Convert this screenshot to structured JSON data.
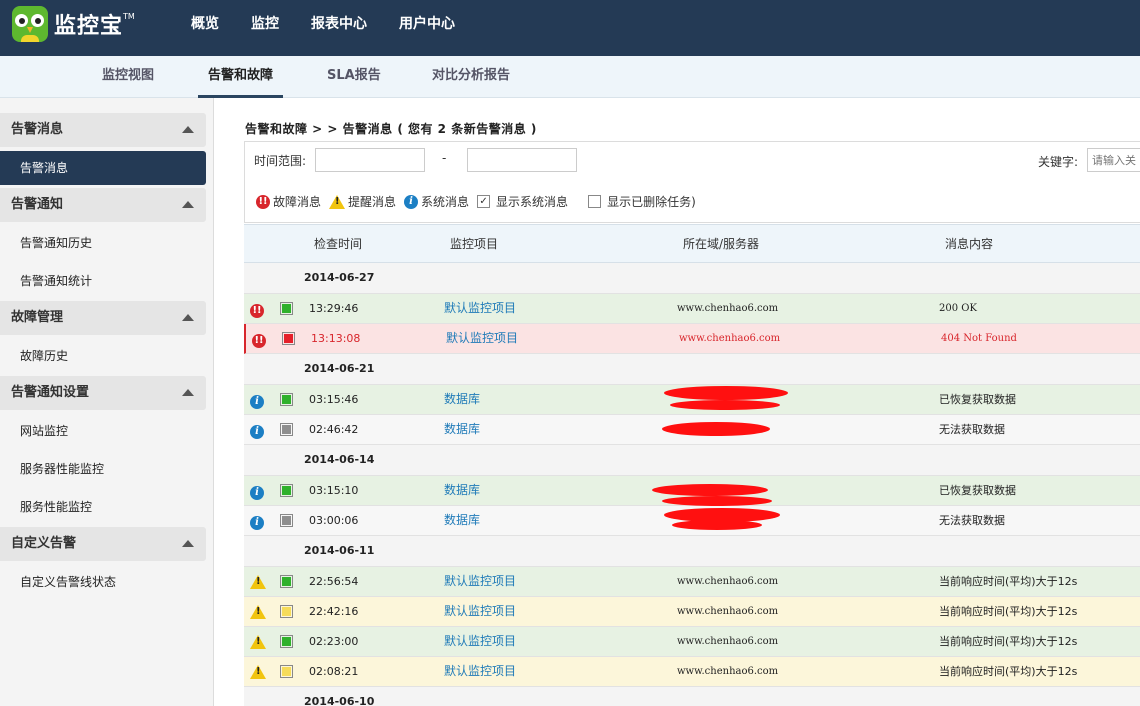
{
  "brand": {
    "name": "监控宝",
    "tm": "TM"
  },
  "topnav": [
    "概览",
    "监控",
    "报表中心",
    "用户中心"
  ],
  "subnav": [
    "监控视图",
    "告警和故障",
    "SLA报告",
    "对比分析报告"
  ],
  "sidebar": {
    "groups": [
      {
        "title": "告警消息",
        "items": [
          "告警消息"
        ]
      },
      {
        "title": "告警通知",
        "items": [
          "告警通知历史",
          "告警通知统计"
        ]
      },
      {
        "title": "故障管理",
        "items": [
          "故障历史"
        ]
      },
      {
        "title": "告警通知设置",
        "items": [
          "网站监控",
          "服务器性能监控",
          "服务性能监控"
        ]
      },
      {
        "title": "自定义告警",
        "items": [
          "自定义告警线状态"
        ]
      }
    ]
  },
  "breadcrumb": "告警和故障 > > 告警消息 ( 您有 2 条新告警消息 )",
  "filter": {
    "time_label": "时间范围:",
    "dash": "-",
    "keyword_label": "关键字:",
    "keyword_placeholder": "请输入关",
    "legend": {
      "fault": "故障消息",
      "warn": "提醒消息",
      "system": "系统消息",
      "show_system": "显示系统消息",
      "show_deleted": "显示已删除任务)"
    }
  },
  "table": {
    "headers": [
      "检查时间",
      "监控项目",
      "所在域/服务器",
      "消息内容"
    ],
    "groups": [
      {
        "date": "2014-06-27",
        "rows": [
          {
            "icon": "fault",
            "status": "green",
            "bg": "green",
            "time": "13:29:46",
            "item": "默认监控项目",
            "host": "www.chenhao6.com",
            "msg": "200 OK"
          },
          {
            "icon": "fault",
            "status": "red",
            "bg": "red",
            "time": "13:13:08",
            "item": "默认监控项目",
            "host": "www.chenhao6.com",
            "msg": "404 Not Found"
          }
        ]
      },
      {
        "date": "2014-06-21",
        "rows": [
          {
            "icon": "info",
            "status": "green",
            "bg": "green",
            "time": "03:15:46",
            "item": "数据库",
            "host": "",
            "msg": "已恢复获取数据"
          },
          {
            "icon": "info",
            "status": "gray",
            "bg": "gray",
            "time": "02:46:42",
            "item": "数据库",
            "host": "",
            "msg": "无法获取数据"
          }
        ]
      },
      {
        "date": "2014-06-14",
        "rows": [
          {
            "icon": "info",
            "status": "green",
            "bg": "green",
            "time": "03:15:10",
            "item": "数据库",
            "host": "",
            "msg": "已恢复获取数据"
          },
          {
            "icon": "info",
            "status": "gray",
            "bg": "gray",
            "time": "03:00:06",
            "item": "数据库",
            "host": "",
            "msg": "无法获取数据"
          }
        ]
      },
      {
        "date": "2014-06-11",
        "rows": [
          {
            "icon": "warn",
            "status": "green",
            "bg": "green",
            "time": "22:56:54",
            "item": "默认监控项目",
            "host": "www.chenhao6.com",
            "msg": "当前响应时间(平均)大于12s"
          },
          {
            "icon": "warn",
            "status": "yellow",
            "bg": "yellow",
            "time": "22:42:16",
            "item": "默认监控项目",
            "host": "www.chenhao6.com",
            "msg": "当前响应时间(平均)大于12s"
          },
          {
            "icon": "warn",
            "status": "green",
            "bg": "green",
            "time": "02:23:00",
            "item": "默认监控项目",
            "host": "www.chenhao6.com",
            "msg": "当前响应时间(平均)大于12s"
          },
          {
            "icon": "warn",
            "status": "yellow",
            "bg": "yellow",
            "time": "02:08:21",
            "item": "默认监控项目",
            "host": "www.chenhao6.com",
            "msg": "当前响应时间(平均)大于12s"
          }
        ]
      },
      {
        "date": "2014-06-10",
        "rows": []
      }
    ]
  }
}
